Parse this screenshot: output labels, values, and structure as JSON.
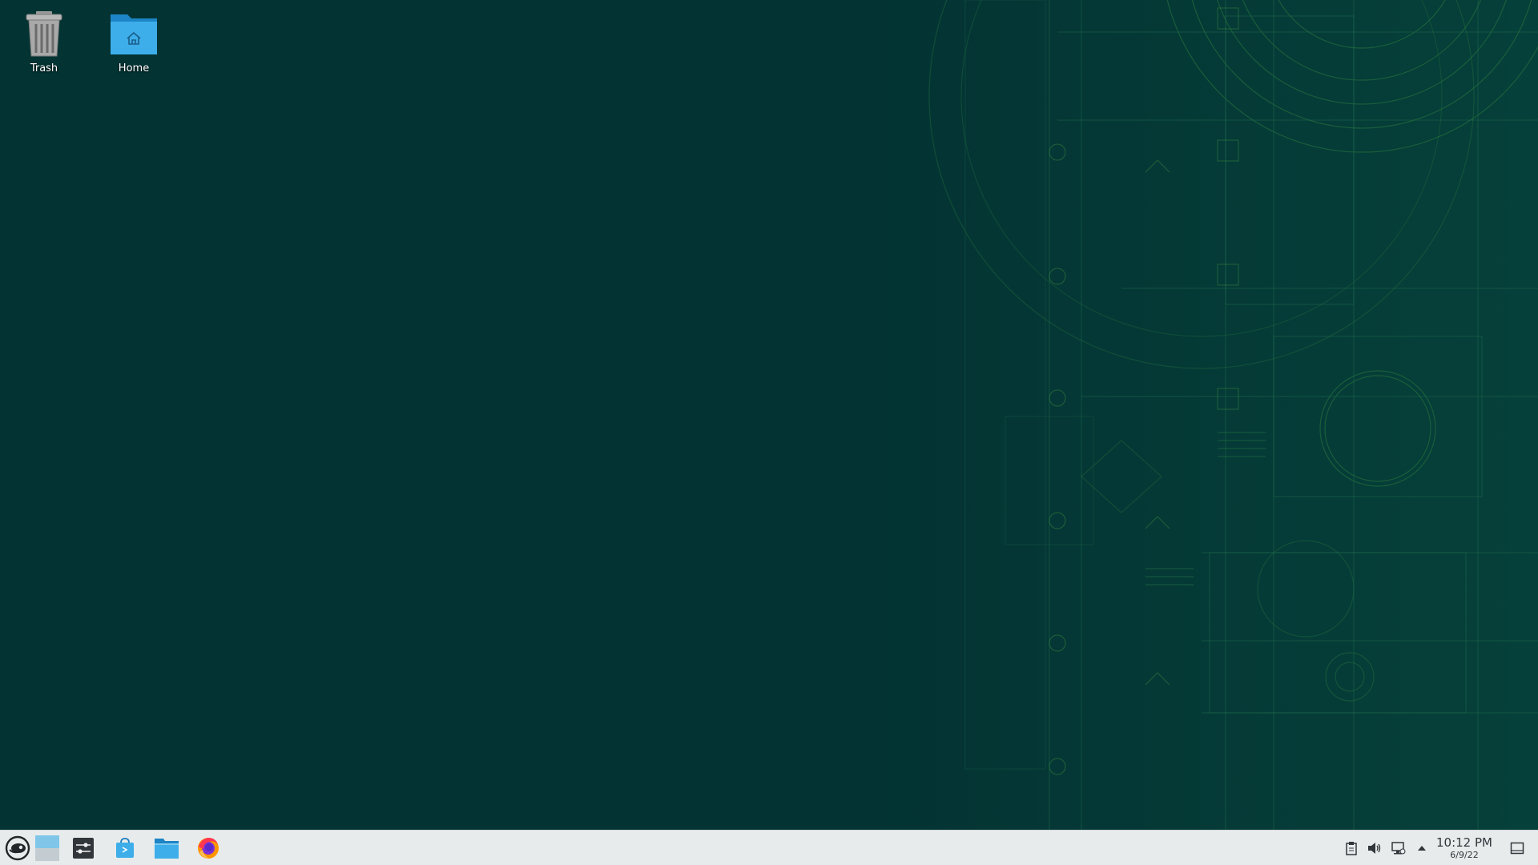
{
  "desktop": {
    "icons": [
      {
        "label": "Trash",
        "icon": "trash-icon"
      },
      {
        "label": "Home",
        "icon": "home-folder-icon"
      }
    ],
    "background_color": "#033333",
    "wallpaper_accent": "#2f7d3a"
  },
  "taskbar": {
    "background_color": "#e7ebec",
    "launchers": [
      {
        "name": "application-launcher",
        "icon": "opensuse-chameleon-icon"
      },
      {
        "name": "pager",
        "icon": "virtual-desktop-icon"
      },
      {
        "name": "system-settings",
        "icon": "settings-sliders-icon"
      },
      {
        "name": "software-center",
        "icon": "discover-bag-icon"
      },
      {
        "name": "file-manager",
        "icon": "folder-icon"
      },
      {
        "name": "web-browser",
        "icon": "firefox-icon"
      }
    ],
    "tray": [
      {
        "name": "clipboard",
        "icon": "clipboard-icon"
      },
      {
        "name": "volume",
        "icon": "speaker-icon"
      },
      {
        "name": "network",
        "icon": "network-wired-icon"
      },
      {
        "name": "show-hidden",
        "icon": "chevron-up-icon"
      }
    ],
    "clock": {
      "time": "10:12 PM",
      "date": "6/9/22"
    },
    "show_desktop_icon": "show-desktop-icon"
  }
}
